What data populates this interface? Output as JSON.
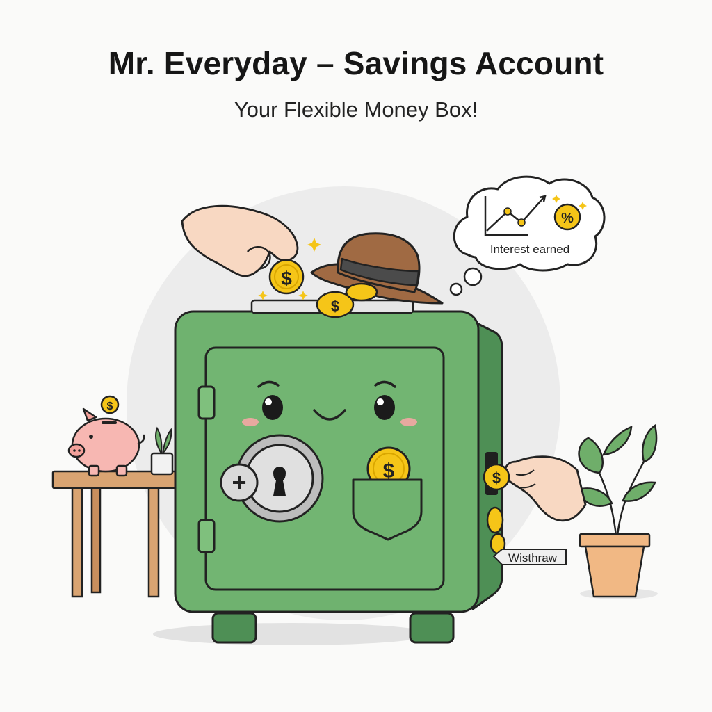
{
  "header": {
    "title": "Mr. Everyday – Savings Account",
    "subtitle": "Your Flexible Money Box!"
  },
  "thought_bubble": {
    "caption": "Interest earned",
    "percent_symbol": "%"
  },
  "withdraw_tag": {
    "label": "Wisthraw"
  },
  "coin_symbol": "$",
  "safe": {
    "deposit_symbol": "+"
  },
  "colors": {
    "safe_green": "#6fb26f",
    "safe_dark": "#4e8f55",
    "coin_gold": "#f5c518",
    "hat_brown": "#a06a43",
    "background_circle": "#ececec",
    "table_wood": "#d9a472",
    "pot_terracotta": "#f1b884",
    "piggy_pink": "#f7b7b2"
  }
}
